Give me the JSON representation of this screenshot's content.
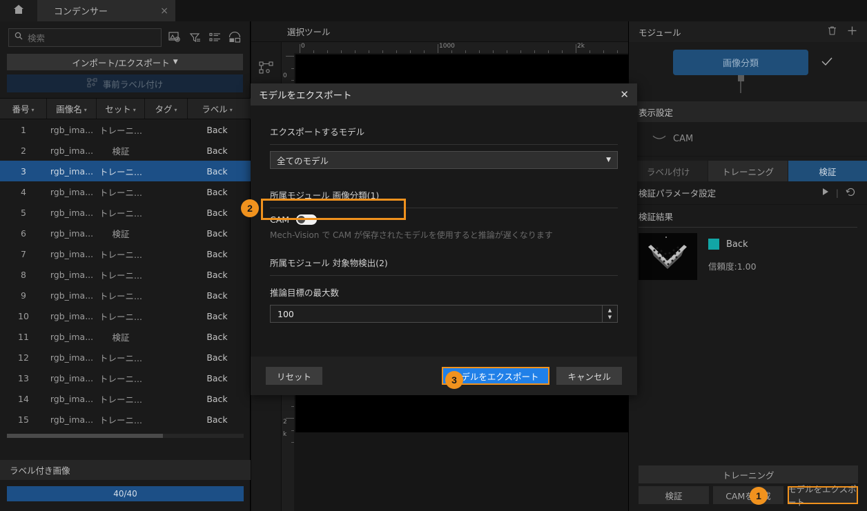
{
  "window": {
    "home_icon": "home-icon",
    "tab_title": "コンデンサー",
    "tab_close": "×"
  },
  "left_panel": {
    "search": {
      "placeholder": "検索",
      "icon": "search-icon",
      "value": ""
    },
    "toolbar_icons": [
      "image-settings-icon",
      "filter-icon",
      "list-view-icon",
      "compare-view-icon"
    ],
    "import_export_label": "インポート/エクスポート",
    "import_export_caret": "▼",
    "prelabel_label": "事前ラベル付け",
    "prelabel_icon": "prelabel-icon",
    "table": {
      "columns": [
        "番号",
        "画像名",
        "セット",
        "タグ",
        "ラベル"
      ],
      "sort_caret": "▾",
      "rows": [
        {
          "no": "1",
          "name": "rgb_ima...",
          "set": "トレーニ...",
          "tag": "",
          "label": "Back",
          "selected": false
        },
        {
          "no": "2",
          "name": "rgb_ima...",
          "set": "検証",
          "tag": "",
          "label": "Back",
          "selected": false
        },
        {
          "no": "3",
          "name": "rgb_ima...",
          "set": "トレーニ...",
          "tag": "",
          "label": "Back",
          "selected": true
        },
        {
          "no": "4",
          "name": "rgb_ima...",
          "set": "トレーニ...",
          "tag": "",
          "label": "Back",
          "selected": false
        },
        {
          "no": "5",
          "name": "rgb_ima...",
          "set": "トレーニ...",
          "tag": "",
          "label": "Back",
          "selected": false
        },
        {
          "no": "6",
          "name": "rgb_ima...",
          "set": "検証",
          "tag": "",
          "label": "Back",
          "selected": false
        },
        {
          "no": "7",
          "name": "rgb_ima...",
          "set": "トレーニ...",
          "tag": "",
          "label": "Back",
          "selected": false
        },
        {
          "no": "8",
          "name": "rgb_ima...",
          "set": "トレーニ...",
          "tag": "",
          "label": "Back",
          "selected": false
        },
        {
          "no": "9",
          "name": "rgb_ima...",
          "set": "トレーニ...",
          "tag": "",
          "label": "Back",
          "selected": false
        },
        {
          "no": "10",
          "name": "rgb_ima...",
          "set": "トレーニ...",
          "tag": "",
          "label": "Back",
          "selected": false
        },
        {
          "no": "11",
          "name": "rgb_ima...",
          "set": "検証",
          "tag": "",
          "label": "Back",
          "selected": false
        },
        {
          "no": "12",
          "name": "rgb_ima...",
          "set": "トレーニ...",
          "tag": "",
          "label": "Back",
          "selected": false
        },
        {
          "no": "13",
          "name": "rgb_ima...",
          "set": "トレーニ...",
          "tag": "",
          "label": "Back",
          "selected": false
        },
        {
          "no": "14",
          "name": "rgb_ima...",
          "set": "トレーニ...",
          "tag": "",
          "label": "Back",
          "selected": false
        },
        {
          "no": "15",
          "name": "rgb_ima...",
          "set": "トレーニ...",
          "tag": "",
          "label": "Back",
          "selected": false
        }
      ]
    },
    "labeled_images_header": "ラベル付き画像",
    "progress_text": "40/40"
  },
  "center": {
    "tool_label": "選択ツール",
    "tool_rail_icon": "node-tool-icon",
    "ruler_h_labels": [
      "0",
      "1000",
      "2k"
    ],
    "ruler_v_labels": [
      "0",
      "0",
      "2",
      "k"
    ],
    "keyboard_fab_icon": "keyboard-icon"
  },
  "right_panel": {
    "module_header": "モジュール",
    "module_delete_icon": "trash-icon",
    "module_add_icon": "plus-icon",
    "module_block_label": "画像分類",
    "module_check_icon": "check-icon",
    "display_settings_header": "表示設定",
    "cam_row_label": "CAM",
    "cam_row_icon": "eye-closed-icon",
    "segments": [
      {
        "label": "ラベル付け",
        "active": false
      },
      {
        "label": "トレーニング",
        "active": false
      },
      {
        "label": "検証",
        "active": true
      }
    ],
    "param_row_label": "検証パラメータ設定",
    "param_play_icon": "play-icon",
    "param_reset_icon": "history-reset-icon",
    "results_header": "検証結果",
    "result": {
      "thumbnail_icon": "sample-thumbnail",
      "swatch_color": "#12a6a6",
      "class_name": "Back",
      "confidence": "信頼度:1.00"
    },
    "buttons": {
      "training": "トレーニング",
      "validate": "検証",
      "generate_cam": "CAMを生成",
      "export_model": "モデルをエクスポート"
    }
  },
  "dialog": {
    "title": "モデルをエクスポート",
    "close_icon": "close-icon",
    "export_model_label": "エクスポートするモデル",
    "export_model_value": "全てのモデル",
    "dropdown_caret": "▼",
    "group1_label": "所属モジュール 画像分類(1)",
    "cam_label": "CAM",
    "cam_enabled": false,
    "cam_hint": "Mech-Vision で CAM が保存されたモデルを使用すると推論が遅くなります",
    "group2_label": "所属モジュール 対象物検出(2)",
    "max_targets_label": "推論目標の最大数",
    "max_targets_value": "100",
    "spinner_up": "▲",
    "spinner_down": "▼",
    "reset_button": "リセット",
    "export_button": "モデルをエクスポート",
    "cancel_button": "キャンセル"
  },
  "badges": {
    "step1": "1",
    "step2": "2",
    "step3": "3"
  },
  "colors": {
    "accent_orange": "#f0921e",
    "primary_blue": "#2080e8",
    "module_blue": "#1f4e79",
    "selection_blue": "#1c4f86",
    "class_teal": "#12a6a6"
  }
}
